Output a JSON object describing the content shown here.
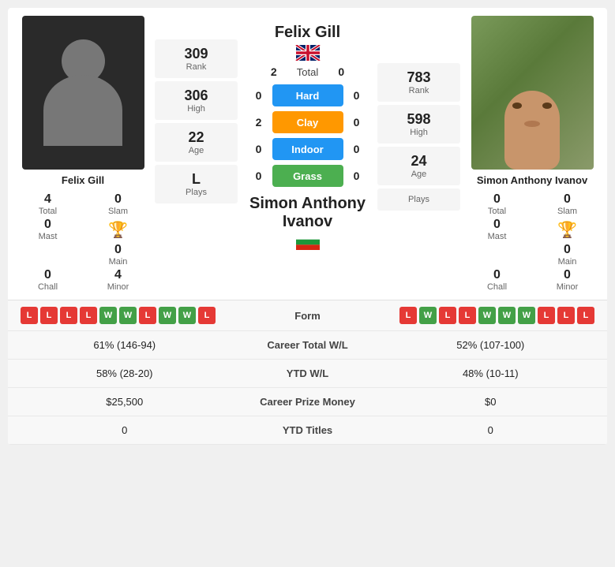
{
  "player1": {
    "name": "Felix Gill",
    "flag": "uk",
    "total_wins": "2",
    "rank": "309",
    "rank_label": "Rank",
    "high": "306",
    "high_label": "High",
    "age": "22",
    "age_label": "Age",
    "plays": "L",
    "plays_label": "Plays",
    "total": "4",
    "total_label": "Total",
    "slam": "0",
    "slam_label": "Slam",
    "mast": "0",
    "mast_label": "Mast",
    "main": "0",
    "main_label": "Main",
    "chall": "0",
    "chall_label": "Chall",
    "minor": "4",
    "minor_label": "Minor",
    "form": [
      "L",
      "L",
      "L",
      "L",
      "W",
      "W",
      "L",
      "W",
      "W",
      "L"
    ],
    "career_wl": "61% (146-94)",
    "ytd_wl": "58% (28-20)",
    "prize": "$25,500",
    "ytd_titles": "0"
  },
  "player2": {
    "name": "Simon Anthony Ivanov",
    "flag": "bg",
    "total_wins": "0",
    "rank": "783",
    "rank_label": "Rank",
    "high": "598",
    "high_label": "High",
    "age": "24",
    "age_label": "Age",
    "plays": "",
    "plays_label": "Plays",
    "total": "0",
    "total_label": "Total",
    "slam": "0",
    "slam_label": "Slam",
    "mast": "0",
    "mast_label": "Mast",
    "main": "0",
    "main_label": "Main",
    "chall": "0",
    "chall_label": "Chall",
    "minor": "0",
    "minor_label": "Minor",
    "form": [
      "L",
      "W",
      "L",
      "L",
      "W",
      "W",
      "W",
      "L",
      "L",
      "L"
    ],
    "career_wl": "52% (107-100)",
    "ytd_wl": "48% (10-11)",
    "prize": "$0",
    "ytd_titles": "0"
  },
  "courts": {
    "total_label": "Total",
    "hard_label": "Hard",
    "clay_label": "Clay",
    "indoor_label": "Indoor",
    "grass_label": "Grass",
    "p1_hard": "0",
    "p2_hard": "0",
    "p1_clay": "2",
    "p2_clay": "0",
    "p1_indoor": "0",
    "p2_indoor": "0",
    "p1_grass": "0",
    "p2_grass": "0"
  },
  "labels": {
    "form": "Form",
    "career_total_wl": "Career Total W/L",
    "ytd_wl": "YTD W/L",
    "career_prize": "Career Prize Money",
    "ytd_titles": "YTD Titles"
  }
}
